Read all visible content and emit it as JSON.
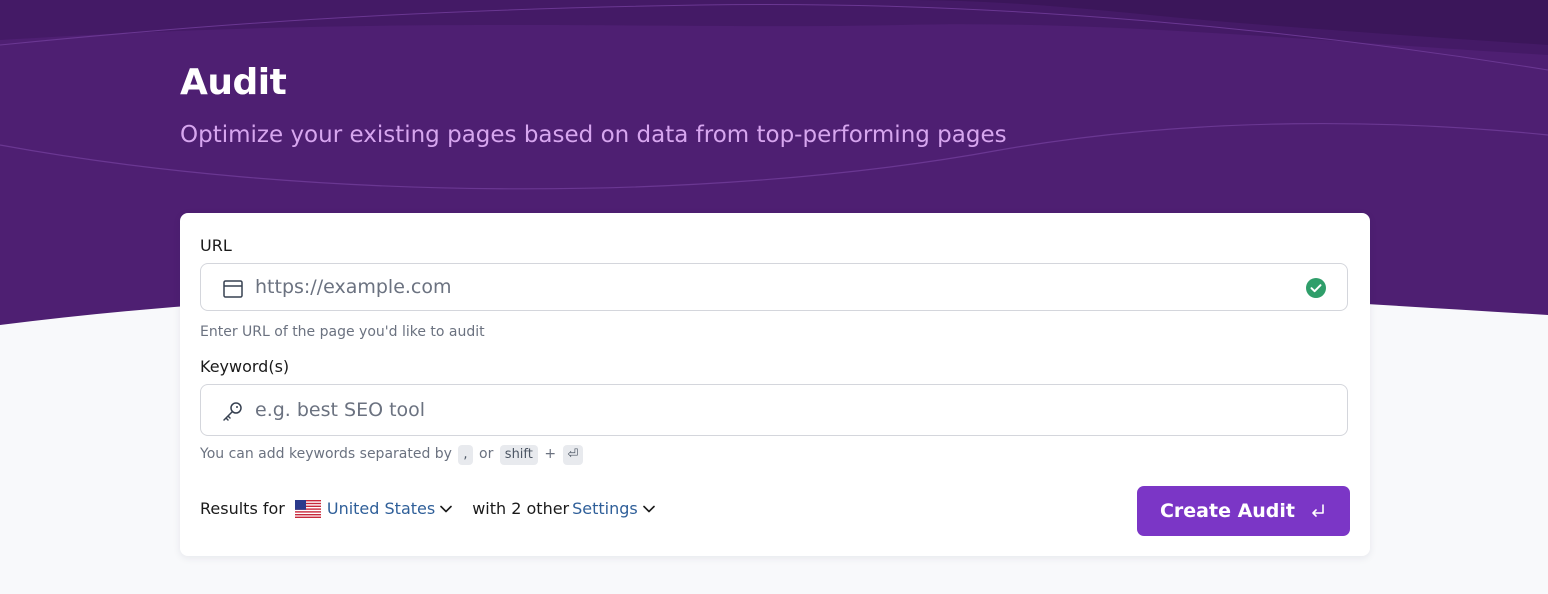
{
  "hero": {
    "title": "Audit",
    "subtitle": "Optimize your existing pages based on data from top-performing pages"
  },
  "form": {
    "url": {
      "label": "URL",
      "placeholder": "https://example.com",
      "value": "",
      "help": "Enter URL of the page you'd like to audit",
      "icon": "browser-window-icon",
      "status_icon": "check-circle-icon"
    },
    "keywords": {
      "label": "Keyword(s)",
      "placeholder": "e.g. best SEO tool",
      "value": "",
      "icon": "key-icon",
      "help_prefix": "You can add keywords separated by",
      "key_comma": ",",
      "or": "or",
      "key_shift": "shift",
      "plus": "+",
      "key_enter": "⏎"
    },
    "results": {
      "prefix": "Results for",
      "country": "United States",
      "flag_icon": "us-flag-icon",
      "middle": "with 2 other",
      "settings": "Settings"
    },
    "create_button": "Create Audit"
  },
  "colors": {
    "hero_bg": "#4e1f72",
    "accent": "#7b36c6",
    "success": "#2f9e6a",
    "link": "#2f5f99"
  }
}
